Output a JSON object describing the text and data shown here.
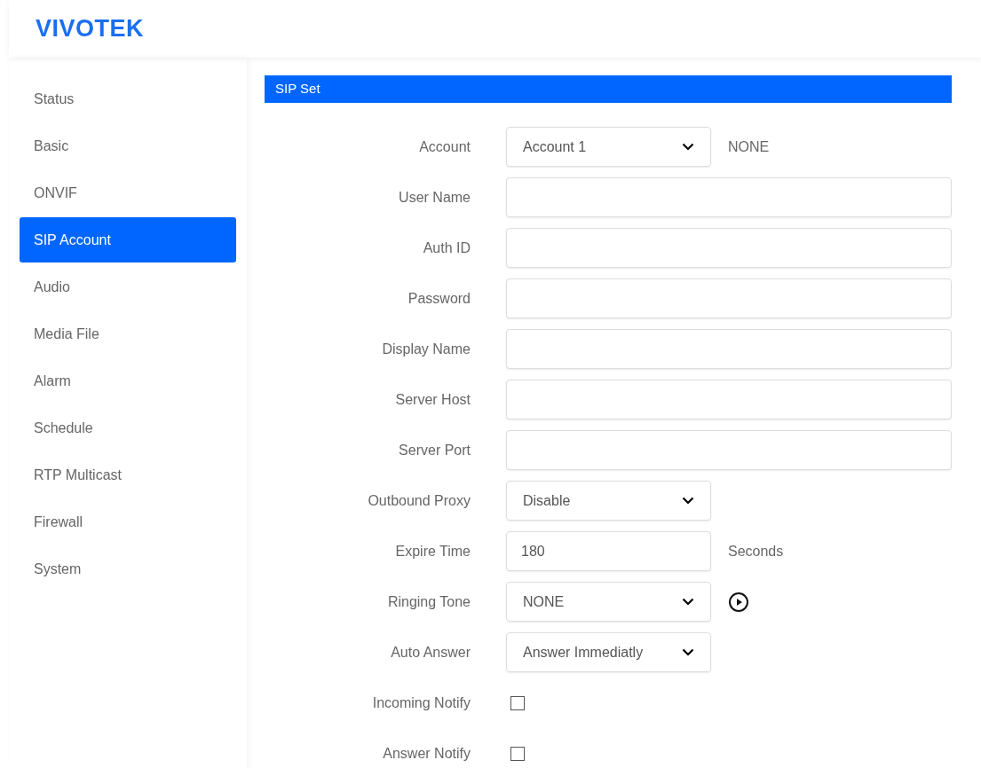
{
  "logo": "VIVOTEK",
  "sidebar": {
    "items": [
      {
        "label": "Status",
        "selected": false
      },
      {
        "label": "Basic",
        "selected": false
      },
      {
        "label": "ONVIF",
        "selected": false
      },
      {
        "label": "SIP Account",
        "selected": true
      },
      {
        "label": "Audio",
        "selected": false
      },
      {
        "label": "Media File",
        "selected": false
      },
      {
        "label": "Alarm",
        "selected": false
      },
      {
        "label": "Schedule",
        "selected": false
      },
      {
        "label": "RTP Multicast",
        "selected": false
      },
      {
        "label": "Firewall",
        "selected": false
      },
      {
        "label": "System",
        "selected": false
      }
    ]
  },
  "section": {
    "title": "SIP Set",
    "fields": [
      {
        "label": "Account",
        "kind": "select",
        "value": "Account 1",
        "extra": {
          "kind": "text",
          "text": "NONE"
        }
      },
      {
        "label": "User Name",
        "kind": "input"
      },
      {
        "label": "Auth ID",
        "kind": "input"
      },
      {
        "label": "Password",
        "kind": "input"
      },
      {
        "label": "Display Name",
        "kind": "input"
      },
      {
        "label": "Server Host",
        "kind": "input"
      },
      {
        "label": "Server Port",
        "kind": "input"
      },
      {
        "label": "Outbound Proxy",
        "kind": "select",
        "value": "Disable"
      },
      {
        "label": "Expire Time",
        "kind": "input",
        "value": "180",
        "extra": {
          "kind": "text",
          "text": "Seconds"
        }
      },
      {
        "label": "Ringing Tone",
        "kind": "select",
        "value": "NONE",
        "extra": {
          "kind": "play"
        }
      },
      {
        "label": "Auto Answer",
        "kind": "select",
        "value": "Answer Immediatly"
      },
      {
        "label": "Incoming Notify",
        "kind": "checkbox",
        "checked": false
      },
      {
        "label": "Answer Notify",
        "kind": "checkbox",
        "checked": false
      }
    ]
  }
}
